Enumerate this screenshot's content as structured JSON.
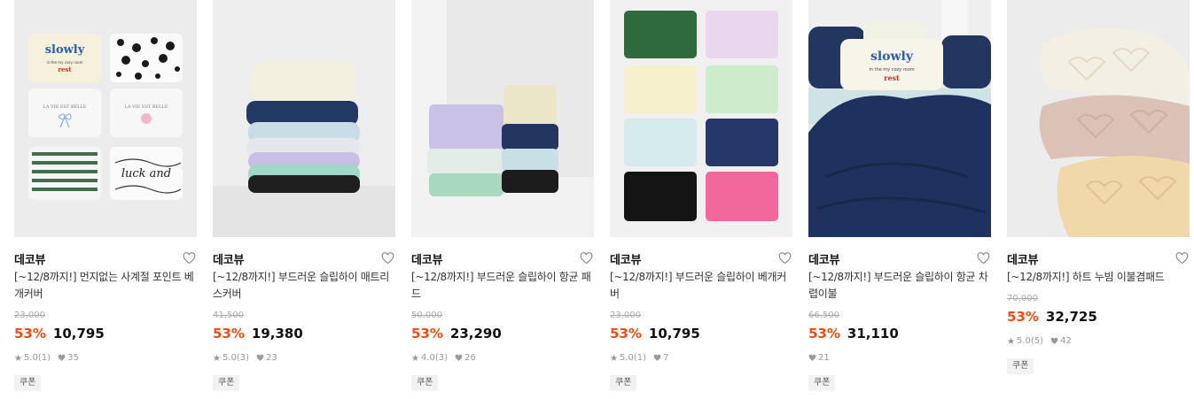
{
  "products": [
    {
      "brand": "데코뷰",
      "title": "[~12/8까지!] 먼지없는 사계절 포인트 베개커버",
      "image_alt": "",
      "original_price": "23,000",
      "discount": "53%",
      "price": "10,795",
      "rating": "5.0",
      "review_count": "(1)",
      "likes": "35",
      "coupon": "쿠폰"
    },
    {
      "brand": "데코뷰",
      "title": "[~12/8까지!] 부드러운 슬립하이 매트리스커버",
      "image_alt": "",
      "original_price": "41,500",
      "discount": "53%",
      "price": "19,380",
      "rating": "5.0",
      "review_count": "(3)",
      "likes": "23",
      "coupon": "쿠폰"
    },
    {
      "brand": "데코뷰",
      "title": "[~12/8까지!] 부드러운 슬립하이 항균 패드",
      "image_alt": "",
      "original_price": "50,000",
      "discount": "53%",
      "price": "23,290",
      "rating": "4.0",
      "review_count": "(3)",
      "likes": "26",
      "coupon": "쿠폰"
    },
    {
      "brand": "데코뷰",
      "title": "[~12/8까지!] 부드러운 슬립하이 베개커버",
      "image_alt": "",
      "original_price": "23,000",
      "discount": "53%",
      "price": "10,795",
      "rating": "5.0",
      "review_count": "(1)",
      "likes": "7",
      "coupon": "쿠폰"
    },
    {
      "brand": "데코뷰",
      "title": "[~12/8까지!] 부드러운 슬립하이 항균 차렵이불",
      "image_alt": "",
      "original_price": "66,500",
      "discount": "53%",
      "price": "31,110",
      "rating": "",
      "review_count": "",
      "likes": "21",
      "coupon": "쿠폰"
    },
    {
      "brand": "데코뷰",
      "title": "[~12/8까지!] 하트 누빔 이불겸패드",
      "image_alt": "",
      "original_price": "70,000",
      "discount": "53%",
      "price": "32,725",
      "rating": "5.0",
      "review_count": "(5)",
      "likes": "42",
      "coupon": "쿠폰"
    }
  ],
  "image_text": {
    "slowly": "slowly",
    "cozy": "in the my cozy room",
    "rest": "rest",
    "lavie": "LA VIE EST BELLE",
    "luck": "luck and"
  },
  "colors": {
    "discount": "#f04e10",
    "brand_text": "#111111",
    "meta": "#999999",
    "coupon_bg": "#f2f2f2"
  },
  "icons": {
    "wishlist": "heart-outline-icon",
    "rating": "star-icon",
    "likes": "heart-filled-icon"
  }
}
